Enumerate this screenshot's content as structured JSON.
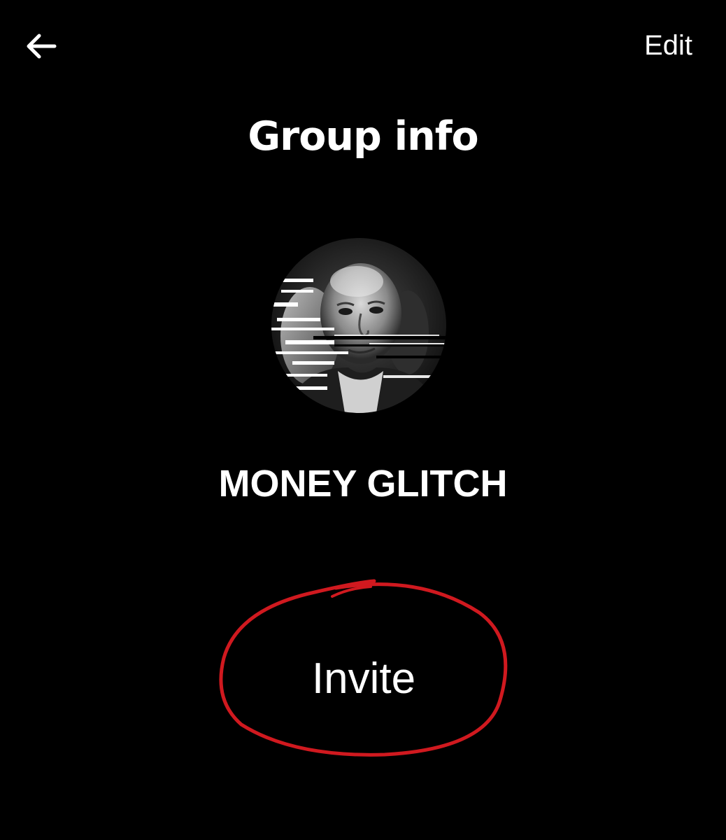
{
  "header": {
    "back_icon": "arrow-left-icon",
    "edit_label": "Edit",
    "title": "Group info"
  },
  "group": {
    "avatar_icon": "group-avatar-portrait",
    "name": "MONEY GLITCH"
  },
  "actions": {
    "invite_label": "Invite"
  },
  "colors": {
    "background": "#000000",
    "text": "#ffffff",
    "annotation": "#d0191f"
  }
}
